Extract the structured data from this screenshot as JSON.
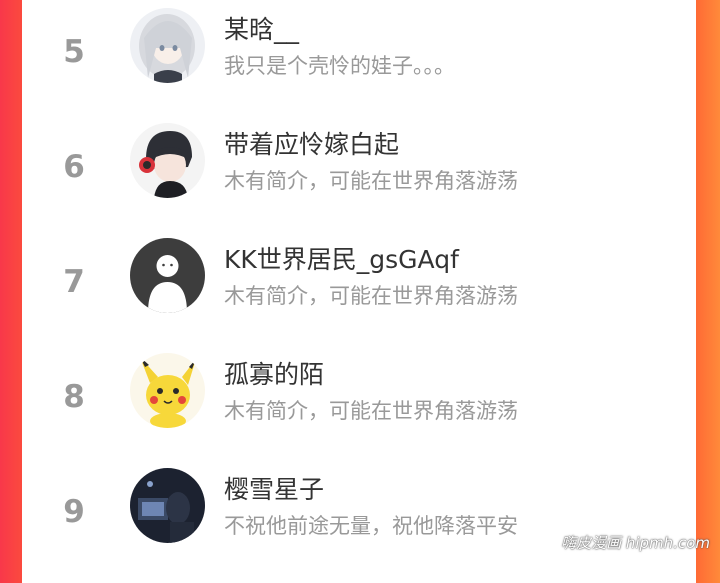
{
  "ranking": [
    {
      "rank": "5",
      "name": "某晗__",
      "bio": "我只是个壳怜的娃子。。。",
      "avatar": "anime-girl-avatar"
    },
    {
      "rank": "6",
      "name": "带着应怜嫁白起",
      "bio": "木有简介，可能在世界角落游荡",
      "avatar": "anime-boy-headphones-avatar"
    },
    {
      "rank": "7",
      "name": "KK世界居民_gsGAqf",
      "bio": "木有简介，可能在世界角落游荡",
      "avatar": "default-user-avatar"
    },
    {
      "rank": "8",
      "name": "孤寡的陌",
      "bio": "木有简介，可能在世界角落游荡",
      "avatar": "pikachu-avatar"
    },
    {
      "rank": "9",
      "name": "樱雪星子",
      "bio": "不祝他前途无量，祝他降落平安",
      "avatar": "dark-photo-avatar"
    }
  ],
  "watermark": "嗨皮漫画 hipmh.com",
  "colors": {
    "left_edge": "#f8384a",
    "right_edge": "#ff7a38",
    "rank_gray": "#999999",
    "name_text": "#333333",
    "bio_text": "#999999"
  }
}
